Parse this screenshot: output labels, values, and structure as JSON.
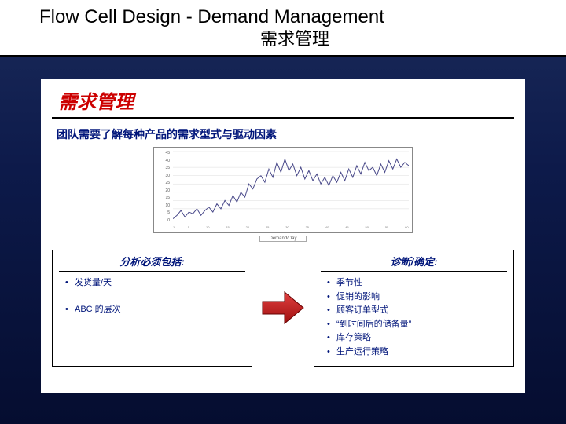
{
  "title": {
    "english": "Flow Cell Design - Demand Management",
    "chinese": "需求管理"
  },
  "panel": {
    "heading": "需求管理",
    "subtitle": "团队需要了解每种产品的需求型式与驱动因素"
  },
  "chart_data": {
    "type": "line",
    "title": "",
    "xlabel": "",
    "ylabel": "",
    "ylim": [
      0,
      45
    ],
    "y_ticks": [
      45,
      40,
      35,
      30,
      25,
      20,
      15,
      10,
      5,
      0
    ],
    "x_ticks": [
      "1",
      "",
      "",
      "",
      "5",
      "",
      "",
      "",
      "",
      "10",
      "",
      "",
      "",
      "",
      "15",
      "",
      "",
      "",
      "",
      "20",
      "",
      "",
      "",
      "",
      "25",
      "",
      "",
      "",
      "",
      "30",
      "",
      "",
      "",
      "",
      "35",
      "",
      "",
      "",
      "",
      "40",
      "",
      "",
      "",
      "",
      "45",
      "",
      "",
      "",
      "",
      "50",
      "",
      "",
      "",
      "",
      "55",
      "",
      "",
      "",
      "",
      "60"
    ],
    "legend": "Demand/Day",
    "series": [
      {
        "name": "demand",
        "values": [
          4,
          6,
          9,
          5,
          8,
          7,
          10,
          6,
          9,
          11,
          8,
          13,
          10,
          15,
          12,
          18,
          14,
          20,
          17,
          25,
          22,
          28,
          30,
          26,
          34,
          29,
          38,
          32,
          40,
          33,
          37,
          30,
          35,
          28,
          33,
          27,
          31,
          25,
          29,
          24,
          30,
          26,
          32,
          27,
          34,
          29,
          36,
          31,
          38,
          33,
          35,
          30,
          37,
          32,
          39,
          34,
          40,
          35,
          38,
          36
        ]
      }
    ]
  },
  "left_box": {
    "header": "分析必须包括:",
    "items": [
      "发货量/天",
      "ABC 的层次"
    ]
  },
  "right_box": {
    "header": "诊断/确定:",
    "items": [
      "季节性",
      "促销的影响",
      "顾客订单型式",
      "“到时间后的储备量”",
      "库存策略",
      "生产运行策略"
    ]
  }
}
